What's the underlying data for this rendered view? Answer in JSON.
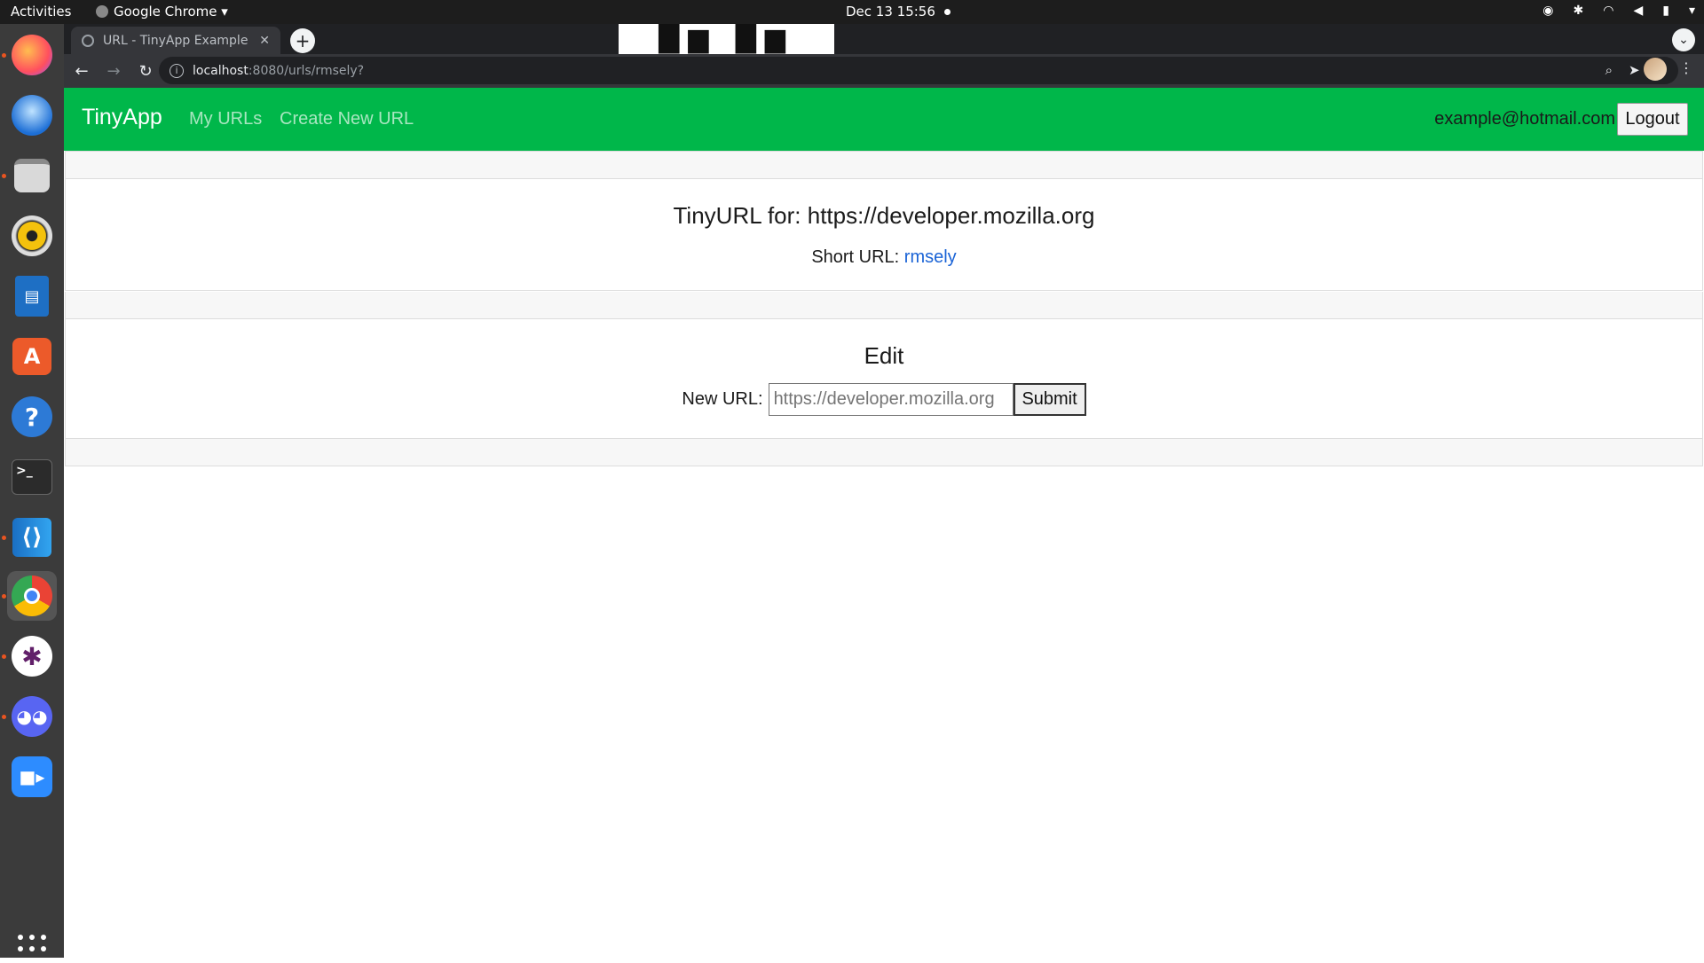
{
  "system": {
    "activities_label": "Activities",
    "app_menu_label": "Google Chrome ▾",
    "clock": "Dec 13  15:56"
  },
  "browser": {
    "tab_title": "URL - TinyApp Example",
    "url_host": "localhost",
    "url_path": ":8080/urls/rmsely?"
  },
  "navbar": {
    "brand": "TinyApp",
    "my_urls": "My URLs",
    "create_new": "Create New URL",
    "user_email": "example@hotmail.com",
    "logout_label": "Logout"
  },
  "url_card": {
    "heading": "TinyURL for: https://developer.mozilla.org",
    "short_label": "Short URL: ",
    "short_value": "rmsely"
  },
  "edit_card": {
    "heading": "Edit",
    "new_url_label": "New URL:",
    "input_placeholder": "https://developer.mozilla.org",
    "submit_label": "Submit"
  },
  "colors": {
    "navbar": "#00b74a",
    "link": "#1a63d6"
  }
}
